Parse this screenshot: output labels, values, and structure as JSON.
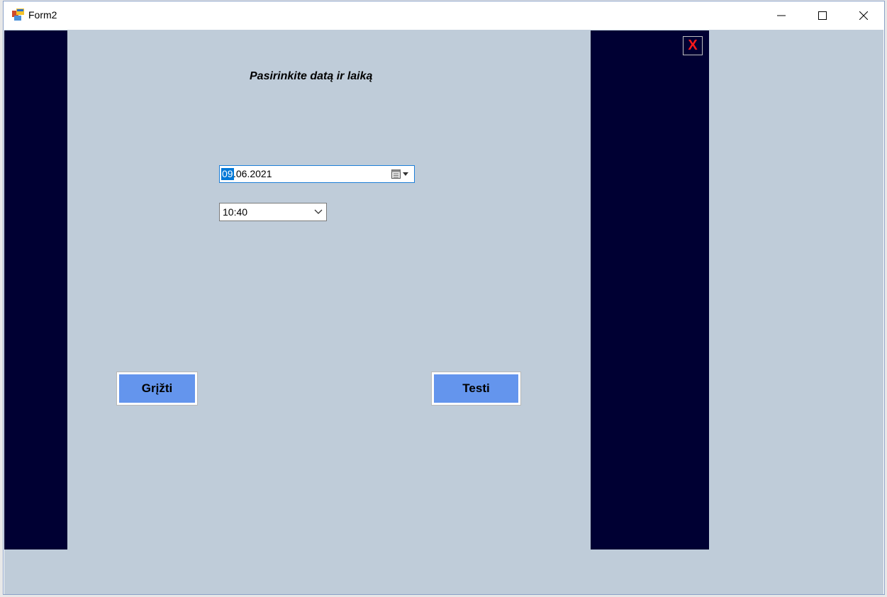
{
  "window": {
    "title": "Form2",
    "icon": "winforms-app-icon"
  },
  "titlebar_buttons": {
    "minimize": "minimize-icon",
    "maximize": "maximize-icon",
    "close": "close-icon"
  },
  "form": {
    "heading": "Pasirinkite datą ir laiką",
    "close_label": "X",
    "date": {
      "day_selected": "09",
      "rest": ".06.2021",
      "icon": "calendar-icon"
    },
    "time": {
      "value": "10:40",
      "icon": "chevron-down-icon"
    },
    "back_label": "Grįžti",
    "next_label": "Testi"
  },
  "colors": {
    "background": "#bfccd9",
    "side_panel": "#000033",
    "button": "#6495ed",
    "close_x": "#ff1a1a",
    "selection": "#0078d7"
  }
}
